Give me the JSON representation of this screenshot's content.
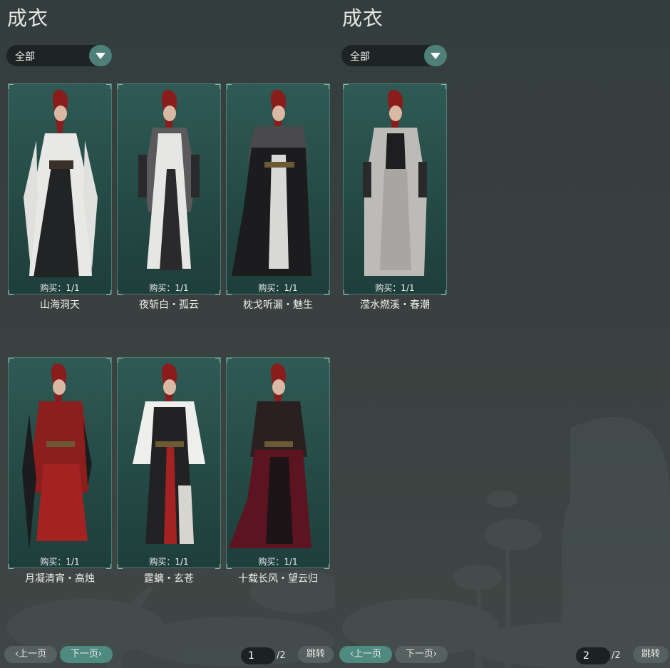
{
  "left": {
    "title": "成衣",
    "filter": "全部",
    "items": [
      {
        "buy": "购买：1/1",
        "name": "山海洞天"
      },
      {
        "buy": "购买：1/1",
        "name": "夜斩白・孤云"
      },
      {
        "buy": "购买：1/1",
        "name": "枕戈听漏・魅生"
      },
      {
        "buy": "购买：1/1",
        "name": "月凝清宵・高烛"
      },
      {
        "buy": "购买：1/1",
        "name": "霆螭・玄苍"
      },
      {
        "buy": "购买：1/1",
        "name": "十载长风・望云归"
      }
    ],
    "pager": {
      "prev": "上一页",
      "next": "下一页",
      "page": "1",
      "total": "/2",
      "jump": "跳转"
    }
  },
  "right": {
    "title": "成衣",
    "filter": "全部",
    "items": [
      {
        "buy": "购买：1/1",
        "name": "滢水燃溪・春潮"
      }
    ],
    "pager": {
      "prev": "上一页",
      "next": "下一页",
      "page": "2",
      "total": "/2",
      "jump": "跳转"
    }
  },
  "colors": {
    "accent": "#4f8a80",
    "card_bg": "#2f5a55",
    "hair": "#8a1c1c"
  }
}
